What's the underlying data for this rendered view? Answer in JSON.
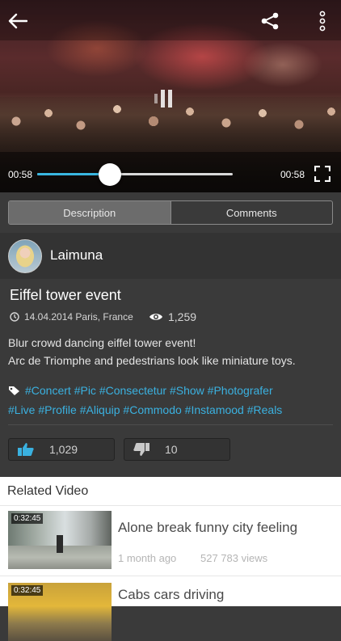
{
  "player": {
    "current_time": "00:58",
    "total_time": "00:58",
    "progress": 0.37,
    "accent": "#39b6e0"
  },
  "tabs": [
    {
      "label": "Description",
      "active": true
    },
    {
      "label": "Comments",
      "active": false
    }
  ],
  "author": {
    "name": "Laimuna"
  },
  "video": {
    "title": "Eiffel tower event",
    "date_location": "14.04.2014 Paris, France",
    "views": "1,259",
    "description_lines": [
      "Blur crowd dancing eiffel tower event!",
      "Arc de Triomphe and pedestrians look like miniature toys."
    ],
    "tags_lines": [
      "#Concert #Pic #Consectetur #Show #Photografer",
      "#Live #Profile #Aliquip #Commodo #Instamood #Reals"
    ],
    "likes": "1,029",
    "dislikes": "10"
  },
  "related": {
    "heading": "Related Video",
    "items": [
      {
        "duration": "0:32:45",
        "title": "Alone break funny city feeling",
        "age": "1 month ago",
        "views": "527 783 views"
      },
      {
        "duration": "0:32:45",
        "title": "Cabs cars driving"
      }
    ]
  },
  "icons": [
    "back-arrow-icon",
    "share-icon",
    "more-vertical-icon",
    "pause-icon",
    "fullscreen-icon",
    "clock-icon",
    "eye-icon",
    "tag-icon",
    "thumbs-up-icon",
    "thumbs-down-icon"
  ]
}
